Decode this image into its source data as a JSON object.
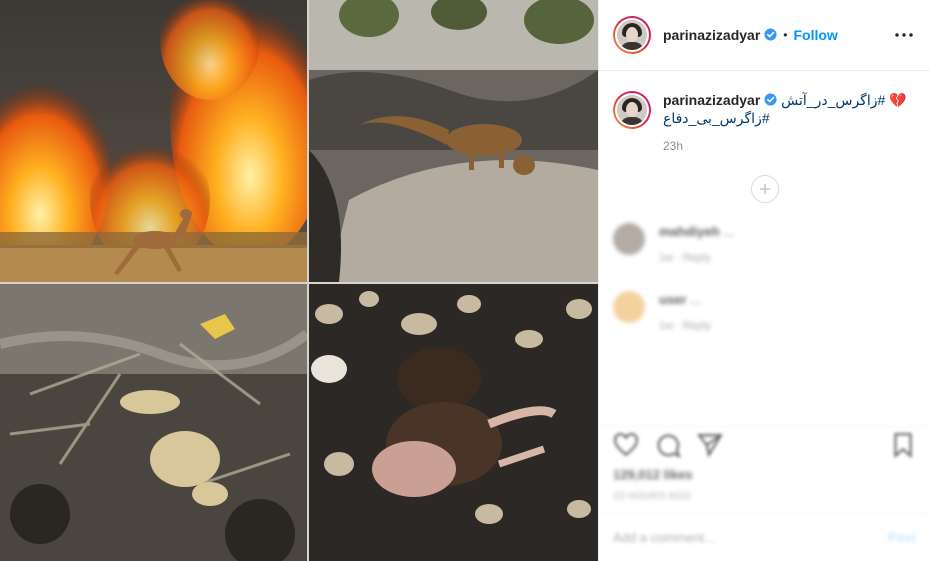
{
  "post": {
    "username": "parinazizadyar",
    "follow_label": "Follow",
    "separator": "•",
    "caption_line1": "زاگرس_در_آتش#",
    "caption_emoji": "💔",
    "caption_line2": "زاگرس_بی_دفاع#",
    "timestamp": "23h",
    "verified_icon": "verified-badge-icon",
    "more_icon": "more-options-icon"
  },
  "comments": [
    {
      "username": "mahdiyeh",
      "text": "...",
      "meta": "1w · Reply",
      "avatar_color": "#9a8f86"
    },
    {
      "username": "user",
      "text": "...",
      "meta": "1w · Reply",
      "avatar_color": "#f1c27d"
    }
  ],
  "footer": {
    "likes": "129,012 likes",
    "ago": "23 HOURS AGO",
    "add_comment_placeholder": "Add a comment...",
    "post_label": "Post"
  },
  "colors": {
    "accent": "#0095f6",
    "hashtag": "#00376b",
    "muted": "#8e8e8e"
  }
}
